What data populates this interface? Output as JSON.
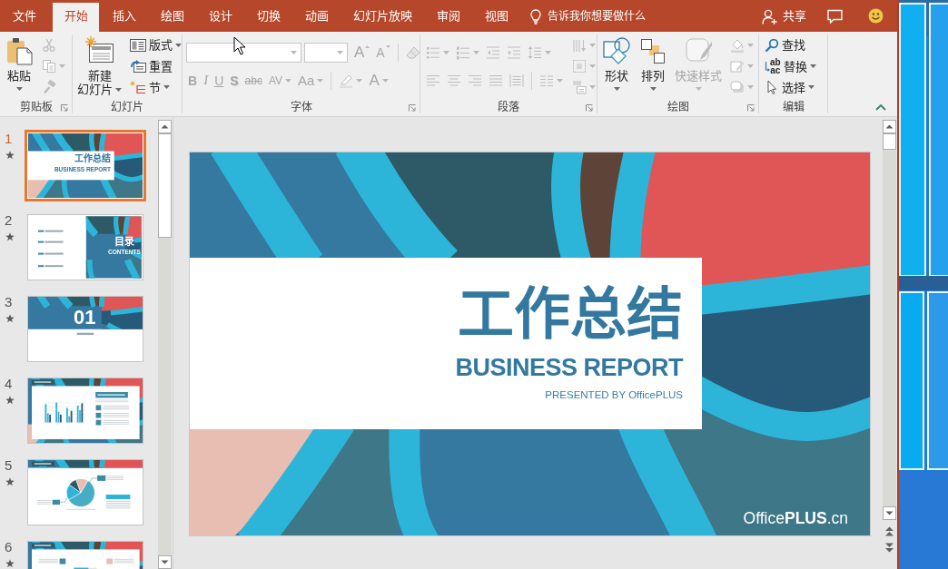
{
  "tabs": [
    {
      "label": "文件",
      "selected": false
    },
    {
      "label": "开始",
      "selected": true
    },
    {
      "label": "插入",
      "selected": false
    },
    {
      "label": "绘图",
      "selected": false
    },
    {
      "label": "设计",
      "selected": false
    },
    {
      "label": "切换",
      "selected": false
    },
    {
      "label": "动画",
      "selected": false
    },
    {
      "label": "幻灯片放映",
      "selected": false
    },
    {
      "label": "审阅",
      "selected": false
    },
    {
      "label": "视图",
      "selected": false
    }
  ],
  "tell_me": {
    "label": "告诉我你想要做什么"
  },
  "share": {
    "label": "共享"
  },
  "ribbon_groups": [
    {
      "label": "剪贴板",
      "launcher": true,
      "columns": [
        {
          "kind": "paste",
          "lines": [
            "粘贴"
          ],
          "dropdown": true,
          "disabled": false
        },
        {
          "kind": "stack",
          "rows": [
            [
              {
                "kind": "cut",
                "disabled": true
              }
            ],
            [
              {
                "kind": "copy",
                "dropdown": true,
                "disabled": true
              }
            ],
            [
              {
                "kind": "painter",
                "disabled": true
              }
            ]
          ]
        }
      ]
    },
    {
      "label": "幻灯片",
      "launcher": false,
      "columns": [
        {
          "kind": "newslide",
          "lines": [
            "新建",
            "幻灯片"
          ],
          "dropdown": true,
          "disabled": false
        },
        {
          "kind": "stack",
          "rows": [
            [
              {
                "kind": "layout",
                "label": "版式",
                "dropdown": true,
                "disabled": false
              }
            ],
            [
              {
                "kind": "reset",
                "label": "重置",
                "disabled": false
              }
            ],
            [
              {
                "kind": "section",
                "label": "节",
                "dropdown": true,
                "disabled": false
              }
            ]
          ]
        }
      ]
    },
    {
      "label": "字体",
      "launcher": true,
      "columns": [
        {
          "kind": "stack",
          "rows": [
            [
              {
                "kind": "fontname"
              },
              {
                "kind": "fontsize"
              },
              {
                "kind": "grow",
                "label": "A",
                "disabled": true
              },
              {
                "kind": "shrink",
                "label": "A",
                "disabled": true
              },
              {
                "kind": "divider"
              },
              {
                "kind": "clear",
                "disabled": true
              }
            ],
            [
              {
                "kind": "bold",
                "label": "B",
                "disabled": true
              },
              {
                "kind": "italic",
                "label": "I",
                "disabled": true
              },
              {
                "kind": "underline",
                "label": "U",
                "disabled": true
              },
              {
                "kind": "shadow",
                "label": "S",
                "disabled": true
              },
              {
                "kind": "strike",
                "label": "abc",
                "disabled": true
              },
              {
                "kind": "spacing",
                "label": "AV",
                "dropdown": true,
                "disabled": true
              },
              {
                "kind": "case",
                "label": "Aa",
                "dropdown": true,
                "disabled": true
              },
              {
                "kind": "divider"
              },
              {
                "kind": "highlight",
                "dropdown": true,
                "disabled": true
              },
              {
                "kind": "color",
                "label": "A",
                "dropdown": true,
                "disabled": true
              }
            ]
          ]
        }
      ]
    },
    {
      "label": "段落",
      "launcher": true,
      "columns": [
        {
          "kind": "stack",
          "rows": [
            [
              {
                "kind": "bullets",
                "dropdown": true,
                "disabled": true
              },
              {
                "kind": "numbering",
                "dropdown": true,
                "disabled": true
              },
              {
                "kind": "outdent",
                "disabled": true
              },
              {
                "kind": "indent",
                "disabled": true
              },
              {
                "kind": "linespacing",
                "dropdown": true,
                "disabled": true
              }
            ],
            [
              {
                "kind": "alignleft",
                "disabled": true
              },
              {
                "kind": "center",
                "disabled": true
              },
              {
                "kind": "alignright",
                "disabled": true
              },
              {
                "kind": "justify",
                "disabled": true
              },
              {
                "kind": "distribute",
                "disabled": true
              },
              {
                "kind": "divider"
              },
              {
                "kind": "columns",
                "dropdown": true,
                "disabled": true
              }
            ]
          ]
        },
        {
          "kind": "stack",
          "rows": [
            [
              {
                "kind": "direction",
                "dropdown": true,
                "disabled": true
              }
            ],
            [
              {
                "kind": "aligntext",
                "dropdown": true,
                "disabled": true
              }
            ],
            [
              {
                "kind": "smartart",
                "dropdown": true,
                "disabled": true
              }
            ]
          ]
        }
      ]
    },
    {
      "label": "绘图",
      "launcher": true,
      "columns": [
        {
          "kind": "shapes",
          "lines": [
            "形状"
          ],
          "dropdown": true,
          "disabled": false
        },
        {
          "kind": "arrange",
          "lines": [
            "排列"
          ],
          "dropdown": true,
          "disabled": false
        },
        {
          "kind": "quickstyles",
          "lines": [
            "快速样式"
          ],
          "dropdown": true,
          "disabled": true
        },
        {
          "kind": "stack",
          "rows": [
            [
              {
                "kind": "fill",
                "dropdown": true,
                "disabled": true
              }
            ],
            [
              {
                "kind": "outline",
                "dropdown": true,
                "disabled": true
              }
            ],
            [
              {
                "kind": "effects",
                "dropdown": true,
                "disabled": true
              }
            ]
          ]
        }
      ]
    },
    {
      "label": "编辑",
      "launcher": false,
      "columns": [
        {
          "kind": "stack",
          "rows": [
            [
              {
                "kind": "find",
                "label": "查找",
                "disabled": false
              }
            ],
            [
              {
                "kind": "replace",
                "label": "替换",
                "glyphs": [
                  "ab",
                  "ac"
                ],
                "dropdown": true,
                "disabled": false
              }
            ],
            [
              {
                "kind": "select",
                "label": "选择",
                "dropdown": true,
                "disabled": false
              }
            ]
          ]
        }
      ]
    }
  ],
  "slides": [
    {
      "number": "1",
      "selected": true,
      "animated": true,
      "kind": "title",
      "texts": [
        "工作总结",
        "BUSINESS REPORT"
      ]
    },
    {
      "number": "2",
      "selected": false,
      "animated": true,
      "kind": "contents",
      "texts": [
        "目录",
        "CONTENTS"
      ]
    },
    {
      "number": "3",
      "selected": false,
      "animated": true,
      "kind": "section",
      "texts": [
        "01"
      ]
    },
    {
      "number": "4",
      "selected": false,
      "animated": true,
      "kind": "chart"
    },
    {
      "number": "5",
      "selected": false,
      "animated": true,
      "kind": "pie"
    },
    {
      "number": "6",
      "selected": false,
      "animated": true,
      "kind": "list"
    }
  ],
  "slide": {
    "title": "工作总结",
    "subtitle": "BUSINESS REPORT",
    "byline": "PRESENTED BY OfficePLUS",
    "logo": "Office**PLUS**.cn"
  }
}
